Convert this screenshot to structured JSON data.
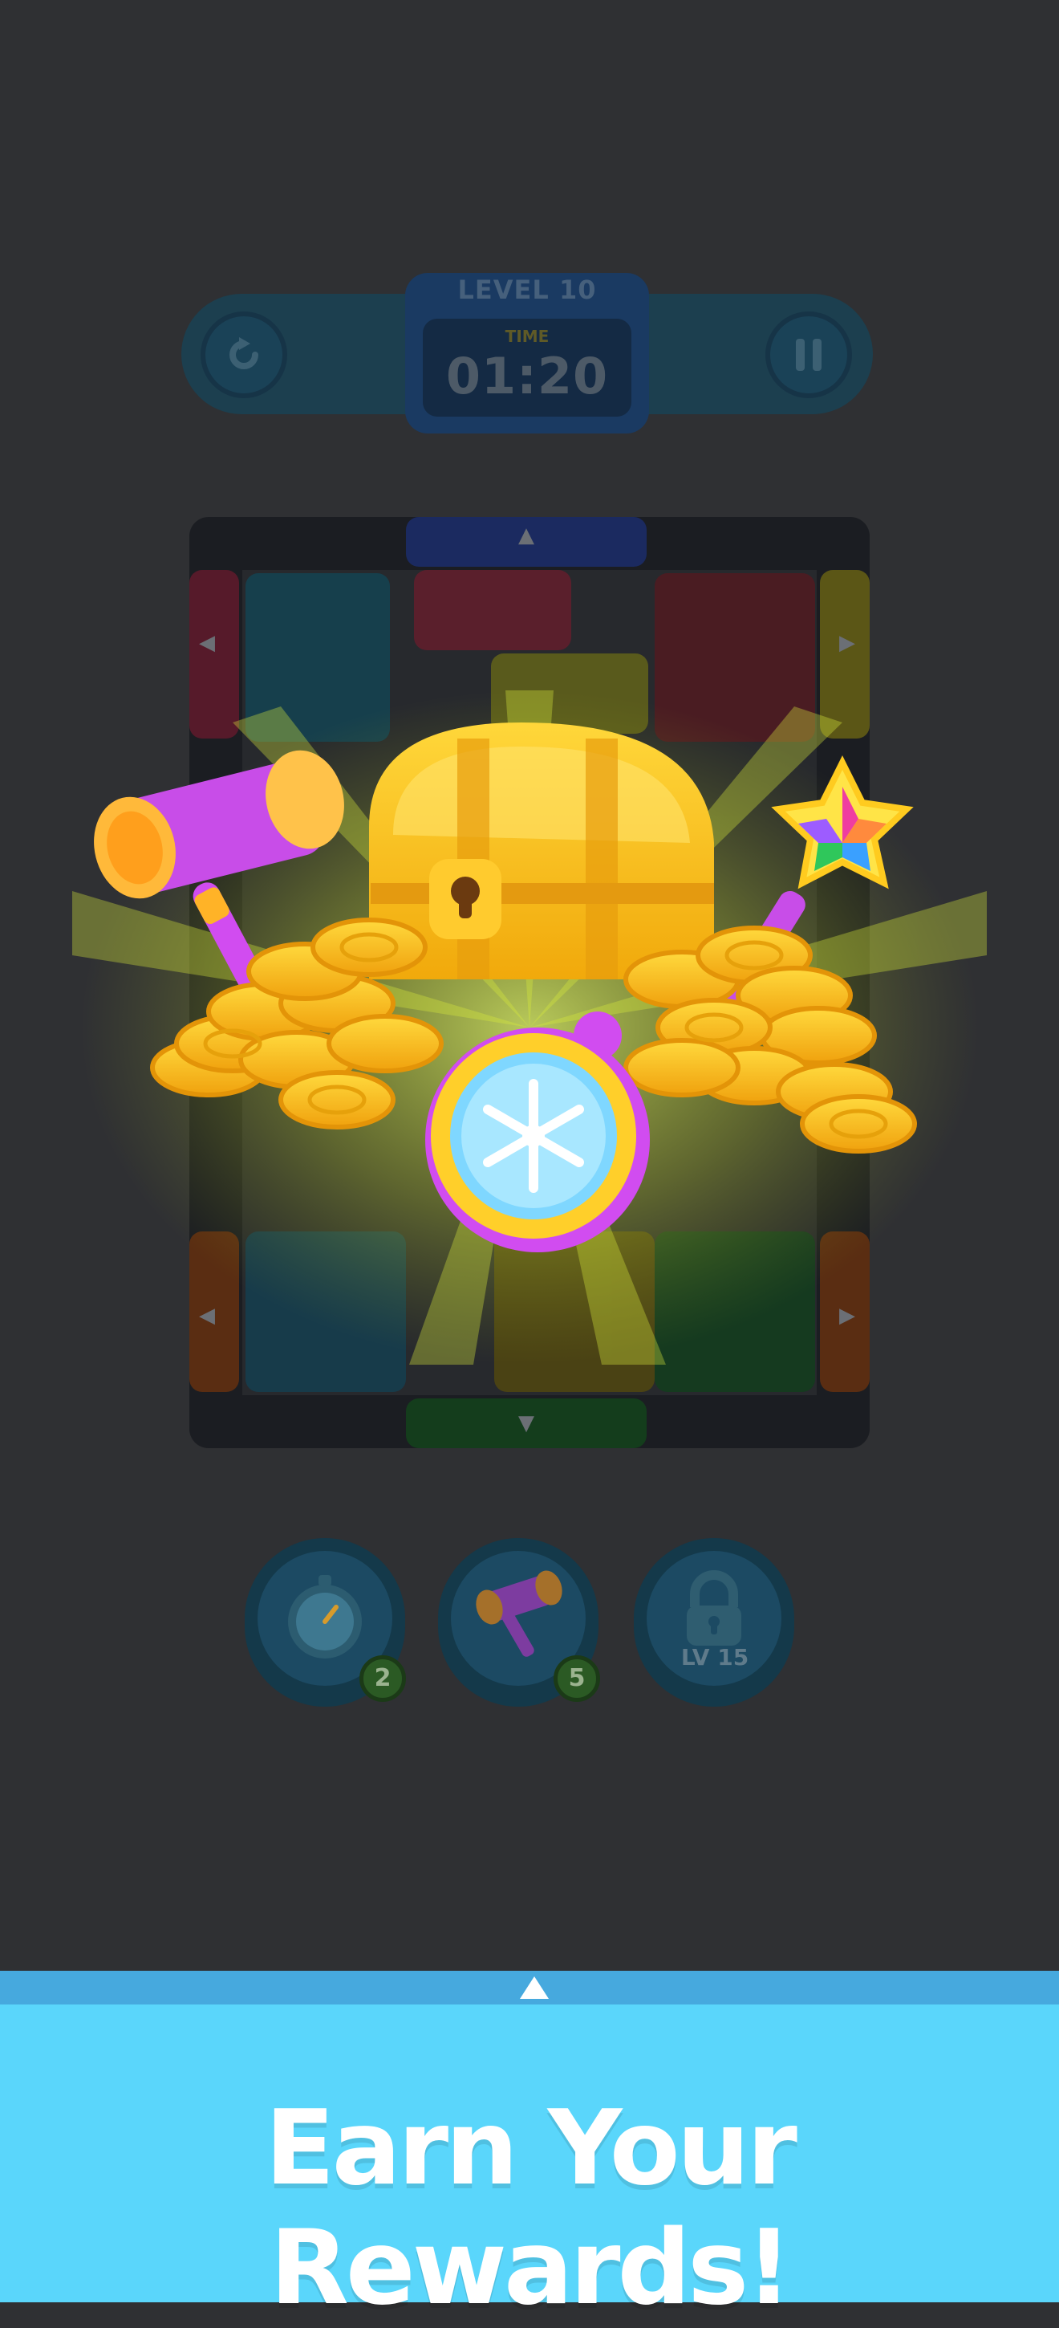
{
  "hud": {
    "level_label": "LEVEL 10",
    "time_label": "TIME",
    "time_value": "01:20",
    "restart_icon": "restart-icon",
    "pause_icon": "pause-icon"
  },
  "board": {
    "arrow_up": "▲",
    "arrow_down": "▼",
    "arrow_left": "◀",
    "arrow_right": "▶"
  },
  "powerups": [
    {
      "icon": "stopwatch-freeze-icon",
      "count": "2"
    },
    {
      "icon": "hammer-icon",
      "count": "5"
    },
    {
      "icon": "lock-icon",
      "label": "LV 15"
    }
  ],
  "reward": {
    "icons": [
      "hammer-icon",
      "treasure-chest-icon",
      "magic-wand-star-icon",
      "coin-pile-icon",
      "freeze-timer-icon"
    ]
  },
  "banner": {
    "text": "Earn Your Rewards!",
    "color": "#5ad6fb"
  }
}
